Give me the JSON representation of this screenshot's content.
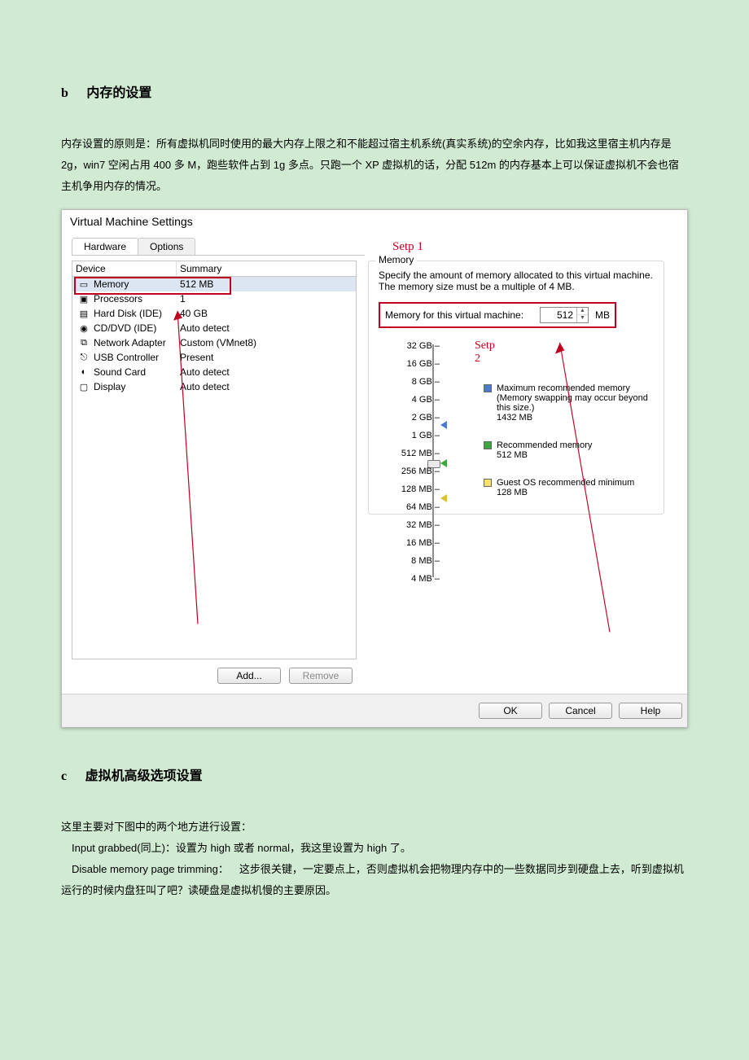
{
  "section_b": {
    "id": "b",
    "title": "内存的设置",
    "para": "内存设置的原则是：所有虚拟机同时使用的最大内存上限之和不能超过宿主机系统(真实系统)的空余内存，比如我这里宿主机内存是 2g，win7 空闲占用 400 多 M，跑些软件占到 1g 多点。只跑一个 XP 虚拟机的话，分配 512m 的内存基本上可以保证虚拟机不会也宿主机争用内存的情况。"
  },
  "vm_settings": {
    "window_title": "Virtual Machine Settings",
    "tabs": {
      "hardware": "Hardware",
      "options": "Options"
    },
    "step1_label": "Setp 1",
    "step2_label": "Setp 2",
    "device_header": {
      "device": "Device",
      "summary": "Summary"
    },
    "devices": [
      {
        "name": "Memory",
        "summary": "512 MB",
        "icon": "memory-icon",
        "selected": true
      },
      {
        "name": "Processors",
        "summary": "1",
        "icon": "cpu-icon"
      },
      {
        "name": "Hard Disk (IDE)",
        "summary": "40 GB",
        "icon": "hdd-icon"
      },
      {
        "name": "CD/DVD (IDE)",
        "summary": "Auto detect",
        "icon": "cd-icon"
      },
      {
        "name": "Network Adapter",
        "summary": "Custom (VMnet8)",
        "icon": "nic-icon"
      },
      {
        "name": "USB Controller",
        "summary": "Present",
        "icon": "usb-icon"
      },
      {
        "name": "Sound Card",
        "summary": "Auto detect",
        "icon": "sound-icon"
      },
      {
        "name": "Display",
        "summary": "Auto detect",
        "icon": "display-icon"
      }
    ],
    "buttons": {
      "add": "Add...",
      "remove": "Remove",
      "ok": "OK",
      "cancel": "Cancel",
      "help": "Help"
    },
    "memory_panel": {
      "title": "Memory",
      "desc": "Specify the amount of memory allocated to this virtual machine. The memory size must be a multiple of 4 MB.",
      "input_label": "Memory for this virtual machine:",
      "input_value": "512",
      "unit": "MB",
      "ticks": [
        "32 GB",
        "16 GB",
        "8 GB",
        "4 GB",
        "2 GB",
        "1 GB",
        "512 MB",
        "256 MB",
        "128 MB",
        "64 MB",
        "32 MB",
        "16 MB",
        "8 MB",
        "4 MB"
      ],
      "legend": {
        "max_label": "Maximum recommended memory",
        "max_note": "(Memory swapping may occur beyond this size.)",
        "max_value": "1432 MB",
        "rec_label": "Recommended memory",
        "rec_value": "512 MB",
        "min_label": "Guest OS recommended minimum",
        "min_value": "128 MB"
      }
    }
  },
  "section_c": {
    "id": "c",
    "title": "虚拟机高级选项设置",
    "para1": "这里主要对下图中的两个地方进行设置：",
    "para2": " Input grabbed(同上)：设置为 high 或者 normal，我这里设置为 high 了。",
    "para3": " Disable memory page trimming： 这步很关键，一定要点上，否则虚拟机会把物理内存中的一些数据同步到硬盘上去，听到虚拟机运行的时候内盘狂叫了吧？读硬盘是虚拟机慢的主要原因。"
  }
}
